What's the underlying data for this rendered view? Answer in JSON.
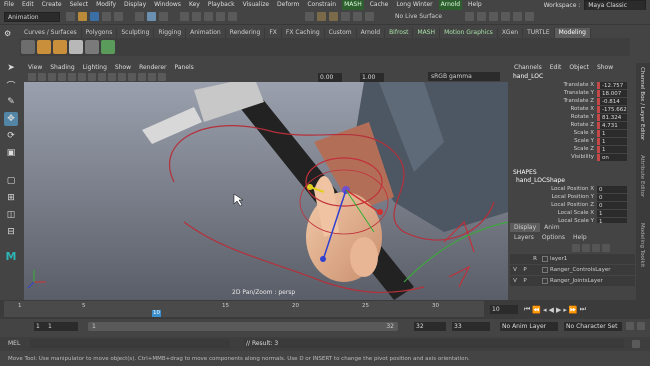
{
  "menubar": {
    "items": [
      "File",
      "Edit",
      "Create",
      "Select",
      "Modify",
      "Display",
      "Windows",
      "Key",
      "Playback",
      "Visualize",
      "Deform",
      "Constrain",
      "MASH",
      "Cache",
      "Long Winter",
      "Arnold",
      "Help"
    ],
    "workspace_label": "Workspace :",
    "workspace_value": "Maya Classic"
  },
  "status": {
    "mode": "Animation",
    "live_surface": "No Live Surface"
  },
  "shelf": {
    "tabs": [
      "Curves / Surfaces",
      "Polygons",
      "Sculpting",
      "Rigging",
      "Animation",
      "Rendering",
      "FX",
      "FX Caching",
      "Custom",
      "Arnold",
      "Bifrost",
      "MASH",
      "Motion Graphics",
      "XGen",
      "TURTLE",
      "Modeling"
    ],
    "active": "Modeling"
  },
  "viewport": {
    "menu": [
      "View",
      "Shading",
      "Lighting",
      "Show",
      "Renderer",
      "Panels"
    ],
    "exposure": "0.00",
    "gamma": "1.00",
    "color_space": "sRGB gamma",
    "camera_label": "2D Pan/Zoom : persp"
  },
  "channelbox": {
    "menu": [
      "Channels",
      "Edit",
      "Object",
      "Show"
    ],
    "object": "hand_LOC",
    "attrs": [
      {
        "name": "Translate X",
        "value": "-12.757"
      },
      {
        "name": "Translate Y",
        "value": "18.007"
      },
      {
        "name": "Translate Z",
        "value": "-0.814"
      },
      {
        "name": "Rotate X",
        "value": "-175.662"
      },
      {
        "name": "Rotate Y",
        "value": "81.324"
      },
      {
        "name": "Rotate Z",
        "value": "4.731"
      },
      {
        "name": "Scale X",
        "value": "1"
      },
      {
        "name": "Scale Y",
        "value": "1"
      },
      {
        "name": "Scale Z",
        "value": "1"
      },
      {
        "name": "Visibility",
        "value": "on"
      }
    ],
    "shapes_title": "SHAPES",
    "shape_name": "hand_LOCShape",
    "shape_attrs": [
      {
        "name": "Local Position X",
        "value": "0"
      },
      {
        "name": "Local Position Y",
        "value": "0"
      },
      {
        "name": "Local Position Z",
        "value": "0"
      },
      {
        "name": "Local Scale X",
        "value": "1"
      },
      {
        "name": "Local Scale Y",
        "value": "1"
      }
    ]
  },
  "side_tabs": [
    "Channel Box / Layer Editor",
    "Attribute Editor",
    "Modeling Toolkit"
  ],
  "layers": {
    "tabs": [
      "Display",
      "Anim"
    ],
    "menu": [
      "Layers",
      "Options",
      "Help"
    ],
    "rows": [
      {
        "v": "",
        "p": "",
        "r": "R",
        "name": "layer1"
      },
      {
        "v": "V",
        "p": "P",
        "r": "",
        "name": "Ranger_ControlsLayer"
      },
      {
        "v": "V",
        "p": "P",
        "r": "",
        "name": "Ranger_JointsLayer"
      }
    ]
  },
  "timeline": {
    "current_frame": "10",
    "ticks": [
      "1",
      "5",
      "10",
      "15",
      "20",
      "25",
      "30"
    ],
    "frame_field": "10"
  },
  "range": {
    "start": "1",
    "start2": "1",
    "slider_start": "1",
    "slider_end": "32",
    "end": "32",
    "end2": "33",
    "anim_layer": "No Anim Layer",
    "char_set": "No Character Set"
  },
  "cmd": {
    "label": "MEL",
    "result": "// Result: 3"
  },
  "help": "Move Tool: Use manipulator to move object(s). Ctrl+MMB+drag to move components along normals. Use D or INSERT to change the pivot position and axis orientation."
}
